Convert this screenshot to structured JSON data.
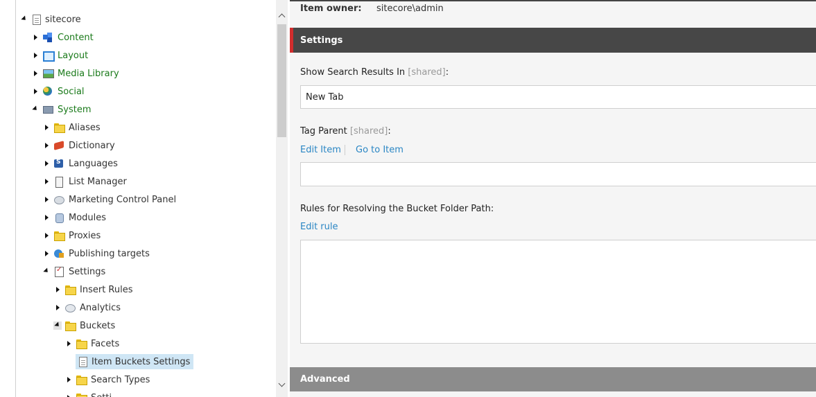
{
  "tree": {
    "items": [
      {
        "label": "sitecore",
        "depth": 0,
        "expanded": true,
        "color": "dark",
        "icon": "document-icon"
      },
      {
        "label": "Content",
        "depth": 1,
        "expanded": false,
        "color": "green",
        "icon": "content-cubes-icon"
      },
      {
        "label": "Layout",
        "depth": 1,
        "expanded": false,
        "color": "green",
        "icon": "layout-icon"
      },
      {
        "label": "Media Library",
        "depth": 1,
        "expanded": false,
        "color": "green",
        "icon": "media-library-icon"
      },
      {
        "label": "Social",
        "depth": 1,
        "expanded": false,
        "color": "green",
        "icon": "social-globe-icon"
      },
      {
        "label": "System",
        "depth": 1,
        "expanded": true,
        "color": "green",
        "icon": "system-icon"
      },
      {
        "label": "Aliases",
        "depth": 2,
        "expanded": false,
        "color": "dark",
        "icon": "folder-icon"
      },
      {
        "label": "Dictionary",
        "depth": 2,
        "expanded": false,
        "color": "dark",
        "icon": "dictionary-book-icon"
      },
      {
        "label": "Languages",
        "depth": 2,
        "expanded": false,
        "color": "dark",
        "icon": "languages-icon"
      },
      {
        "label": "List Manager",
        "depth": 2,
        "expanded": false,
        "color": "dark",
        "icon": "list-manager-icon"
      },
      {
        "label": "Marketing Control Panel",
        "depth": 2,
        "expanded": false,
        "color": "dark",
        "icon": "marketing-control-panel-icon"
      },
      {
        "label": "Modules",
        "depth": 2,
        "expanded": false,
        "color": "dark",
        "icon": "modules-icon"
      },
      {
        "label": "Proxies",
        "depth": 2,
        "expanded": false,
        "color": "dark",
        "icon": "folder-icon"
      },
      {
        "label": "Publishing targets",
        "depth": 2,
        "expanded": false,
        "color": "dark",
        "icon": "publishing-targets-icon"
      },
      {
        "label": "Settings",
        "depth": 2,
        "expanded": true,
        "color": "dark",
        "icon": "settings-checklist-icon"
      },
      {
        "label": "Insert Rules",
        "depth": 3,
        "expanded": false,
        "color": "dark",
        "icon": "folder-icon"
      },
      {
        "label": "Analytics",
        "depth": 3,
        "expanded": false,
        "color": "dark",
        "icon": "analytics-icon"
      },
      {
        "label": "Buckets",
        "depth": 3,
        "expanded": true,
        "color": "dark",
        "icon": "folder-icon"
      },
      {
        "label": "Facets",
        "depth": 4,
        "expanded": false,
        "color": "dark",
        "icon": "folder-icon"
      },
      {
        "label": "Item Buckets Settings",
        "depth": 4,
        "expanded": null,
        "color": "dark",
        "icon": "document-icon",
        "selected": true
      },
      {
        "label": "Search Types",
        "depth": 4,
        "expanded": false,
        "color": "dark",
        "icon": "folder-icon"
      },
      {
        "label": "Setti",
        "depth": 4,
        "expanded": false,
        "color": "dark",
        "icon": "folder-icon"
      }
    ]
  },
  "content": {
    "owner_label": "Item owner:",
    "owner_value": "sitecore\\admin",
    "settings_section": "Settings",
    "advanced_section": "Advanced",
    "field1": {
      "label": "Show Search Results In",
      "shared": "[shared]",
      "colon": ":",
      "value": "New Tab"
    },
    "field2": {
      "label": "Tag Parent",
      "shared": "[shared]",
      "colon": ":",
      "edit_item": "Edit Item",
      "go_to_item": "Go to Item",
      "value": ""
    },
    "field3": {
      "label": "Rules for Resolving the Bucket Folder Path:",
      "edit_rule": "Edit rule"
    }
  },
  "colors": {
    "accent_red": "#d12d2d",
    "link_blue": "#2a86c4",
    "tree_green": "#1a7a1a",
    "selected_bg": "#cfe6f5"
  }
}
